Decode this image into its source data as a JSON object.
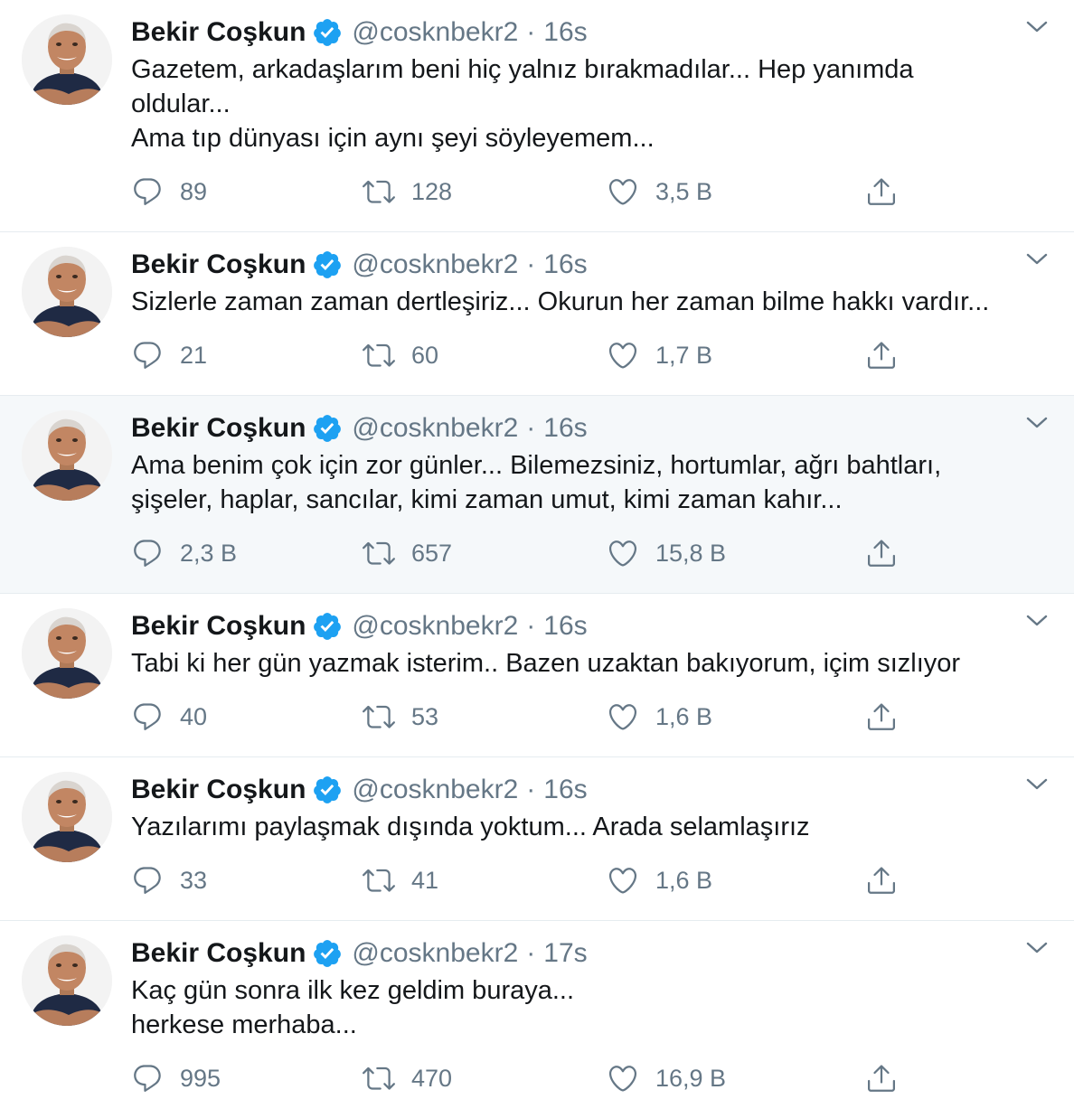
{
  "colors": {
    "text": "#14171a",
    "secondary": "#657786",
    "verified": "#1da1f2",
    "divider": "#e6ecf0",
    "highlight": "#f5f8fa"
  },
  "icons": {
    "reply": "speech-bubble-icon",
    "retweet": "retweet-arrows-icon",
    "like": "heart-icon",
    "share": "share-upload-icon",
    "verified": "verified-badge-icon",
    "menu": "chevron-down-icon"
  },
  "tweets": [
    {
      "name": "Bekir Coşkun",
      "handle": "@cosknbekr2",
      "separator": "·",
      "time": "16s",
      "text": "Gazetem, arkadaşlarım beni hiç yalnız bırakmadılar... Hep yanımda\noldular...\nAma tıp dünyası için aynı şeyi söyleyemem...",
      "replies": "89",
      "retweets": "128",
      "likes": "3,5 B"
    },
    {
      "name": "Bekir Coşkun",
      "handle": "@cosknbekr2",
      "separator": "·",
      "time": "16s",
      "text": "Sizlerle zaman zaman dertleşiriz... Okurun her zaman bilme hakkı vardır...",
      "replies": "21",
      "retweets": "60",
      "likes": "1,7 B"
    },
    {
      "name": "Bekir Coşkun",
      "handle": "@cosknbekr2",
      "separator": "·",
      "time": "16s",
      "text": "Ama benim çok için zor günler... Bilemezsiniz, hortumlar, ağrı bahtları,\nşişeler, haplar, sancılar, kimi zaman umut, kimi zaman kahır...",
      "replies": "2,3 B",
      "retweets": "657",
      "likes": "15,8 B"
    },
    {
      "name": "Bekir Coşkun",
      "handle": "@cosknbekr2",
      "separator": "·",
      "time": "16s",
      "text": "Tabi ki her gün yazmak isterim.. Bazen uzaktan bakıyorum, içim sızlıyor",
      "replies": "40",
      "retweets": "53",
      "likes": "1,6 B"
    },
    {
      "name": "Bekir Coşkun",
      "handle": "@cosknbekr2",
      "separator": "·",
      "time": "16s",
      "text": "Yazılarımı paylaşmak dışında yoktum... Arada selamlaşırız",
      "replies": "33",
      "retweets": "41",
      "likes": "1,6 B"
    },
    {
      "name": "Bekir Coşkun",
      "handle": "@cosknbekr2",
      "separator": "·",
      "time": "17s",
      "text": "Kaç gün sonra ilk kez geldim buraya...\nherkese merhaba...",
      "replies": "995",
      "retweets": "470",
      "likes": "16,9 B"
    }
  ]
}
